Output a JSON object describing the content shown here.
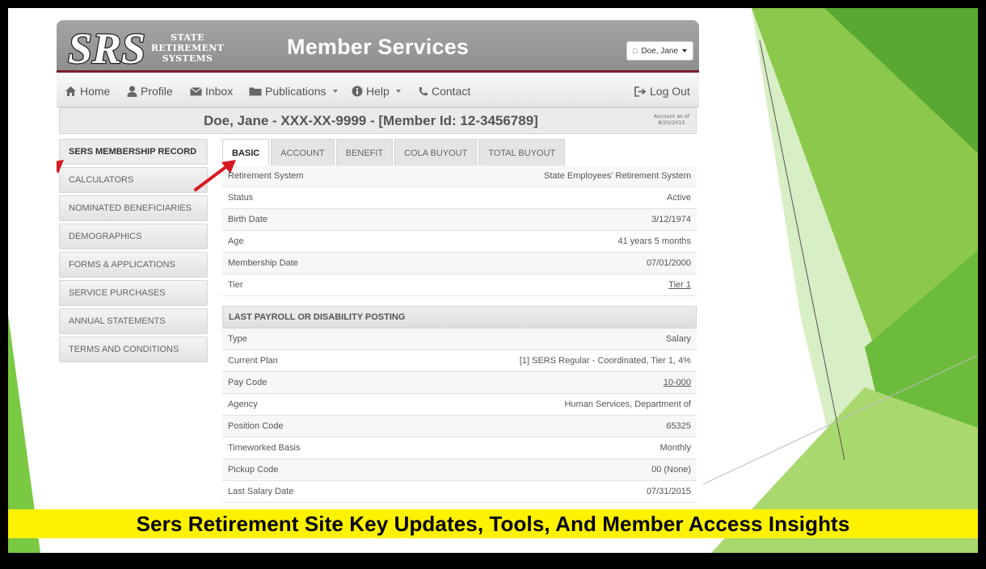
{
  "branding": {
    "logo_letters": "SRS",
    "logo_line1": "STATE",
    "logo_line2": "RETIREMENT",
    "logo_line3": "SYSTEMS",
    "title": "Member Services"
  },
  "user_menu": {
    "label": "Doe, Jane",
    "icon": "user-icon"
  },
  "nav": {
    "home": "Home",
    "profile": "Profile",
    "inbox": "Inbox",
    "publications": "Publications",
    "help": "Help",
    "contact": "Contact",
    "logout": "Log Out"
  },
  "member_header": {
    "line": "Doe, Jane - XXX-XX-9999 - [Member Id: 12-3456789]",
    "account_as_of_label": "Account as of",
    "account_as_of_date": "8/20/2015"
  },
  "sidebar": {
    "items": [
      {
        "label": "SERS MEMBERSHIP RECORD",
        "active": true
      },
      {
        "label": "CALCULATORS"
      },
      {
        "label": "NOMINATED BENEFICIARIES"
      },
      {
        "label": "DEMOGRAPHICS"
      },
      {
        "label": "FORMS & APPLICATIONS"
      },
      {
        "label": "SERVICE PURCHASES"
      },
      {
        "label": "ANNUAL STATEMENTS"
      },
      {
        "label": "TERMS AND CONDITIONS"
      }
    ]
  },
  "tabs": [
    {
      "label": "BASIC",
      "active": true
    },
    {
      "label": "ACCOUNT"
    },
    {
      "label": "BENEFIT"
    },
    {
      "label": "COLA BUYOUT"
    },
    {
      "label": "TOTAL BUYOUT"
    }
  ],
  "basic_rows": [
    {
      "label": "Retirement System",
      "value": "State Employees' Retirement System"
    },
    {
      "label": "Status",
      "value": "Active"
    },
    {
      "label": "Birth Date",
      "value": "3/12/1974"
    },
    {
      "label": "Age",
      "value": "41 years 5 months"
    },
    {
      "label": "Membership Date",
      "value": "07/01/2000"
    },
    {
      "label": "Tier",
      "value": "Tier 1"
    }
  ],
  "payroll_section": {
    "title": "LAST PAYROLL OR DISABILITY POSTING",
    "rows": [
      {
        "label": "Type",
        "value": "Salary"
      },
      {
        "label": "Current Plan",
        "value": "[1] SERS Regular - Coordinated, Tier 1, 4%"
      },
      {
        "label": "Pay Code",
        "value": "10-000"
      },
      {
        "label": "Agency",
        "value": "Human Services, Department of"
      },
      {
        "label": "Position Code",
        "value": "65325"
      },
      {
        "label": "Timeworked Basis",
        "value": "Monthly"
      },
      {
        "label": "Pickup Code",
        "value": "00 (None)"
      },
      {
        "label": "Last Salary Date",
        "value": "07/31/2015"
      }
    ]
  },
  "caption": "Sers Retirement Site Key Updates, Tools, And Member Access Insights",
  "colors": {
    "banner_gray": "#999999",
    "banner_rule": "#7a1d2e",
    "arrow_red": "#d71920",
    "caption_yellow": "#fef200",
    "decor_green": "#7ac943"
  }
}
